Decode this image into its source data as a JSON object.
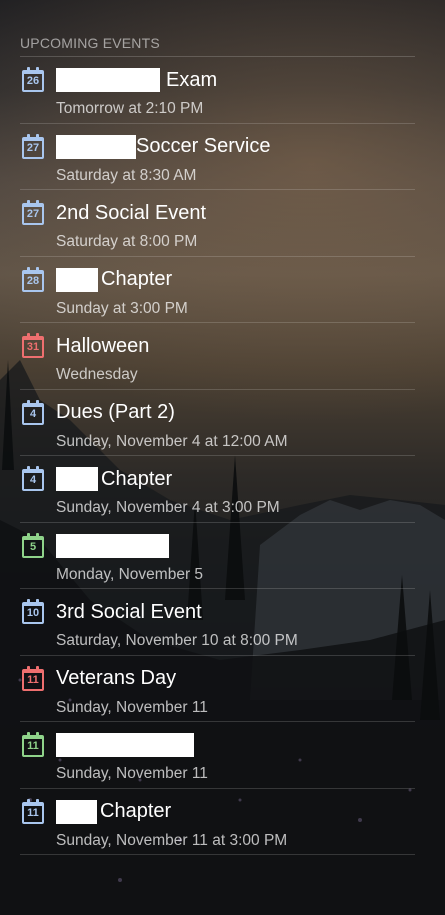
{
  "header": "UPCOMING EVENTS",
  "events": [
    {
      "day": "26",
      "color": "blue",
      "title": "Exam",
      "redacted": 104,
      "gap": 6,
      "time": "Tomorrow at 2:10 PM"
    },
    {
      "day": "27",
      "color": "blue",
      "title": "Soccer Service",
      "redacted": 80,
      "gap": 0,
      "time": "Saturday at 8:30 AM"
    },
    {
      "day": "27",
      "color": "blue",
      "title": "2nd Social Event",
      "redacted": 0,
      "gap": 0,
      "time": "Saturday at 8:00 PM"
    },
    {
      "day": "28",
      "color": "blue",
      "title": "Chapter",
      "redacted": 42,
      "gap": 3,
      "time": "Sunday at 3:00 PM"
    },
    {
      "day": "31",
      "color": "red",
      "title": "Halloween",
      "redacted": 0,
      "gap": 0,
      "time": "Wednesday"
    },
    {
      "day": "4",
      "color": "blue",
      "title": "Dues (Part 2)",
      "redacted": 0,
      "gap": 0,
      "time": "Sunday, November 4 at 12:00 AM"
    },
    {
      "day": "4",
      "color": "blue",
      "title": "Chapter",
      "redacted": 42,
      "gap": 3,
      "time": "Sunday, November 4 at 3:00 PM"
    },
    {
      "day": "5",
      "color": "green",
      "title": "",
      "redacted": 113,
      "gap": 0,
      "time": "Monday, November 5"
    },
    {
      "day": "10",
      "color": "blue",
      "title": "3rd Social Event",
      "redacted": 0,
      "gap": 0,
      "time": "Saturday, November 10 at 8:00 PM"
    },
    {
      "day": "11",
      "color": "red",
      "title": "Veterans Day",
      "redacted": 0,
      "gap": 0,
      "time": "Sunday, November 11"
    },
    {
      "day": "11",
      "color": "green",
      "title": "",
      "redacted": 138,
      "gap": 0,
      "time": "Sunday, November 11"
    },
    {
      "day": "11",
      "color": "blue",
      "title": "Chapter",
      "redacted": 41,
      "gap": 3,
      "time": "Sunday, November 11 at 3:00 PM"
    }
  ]
}
